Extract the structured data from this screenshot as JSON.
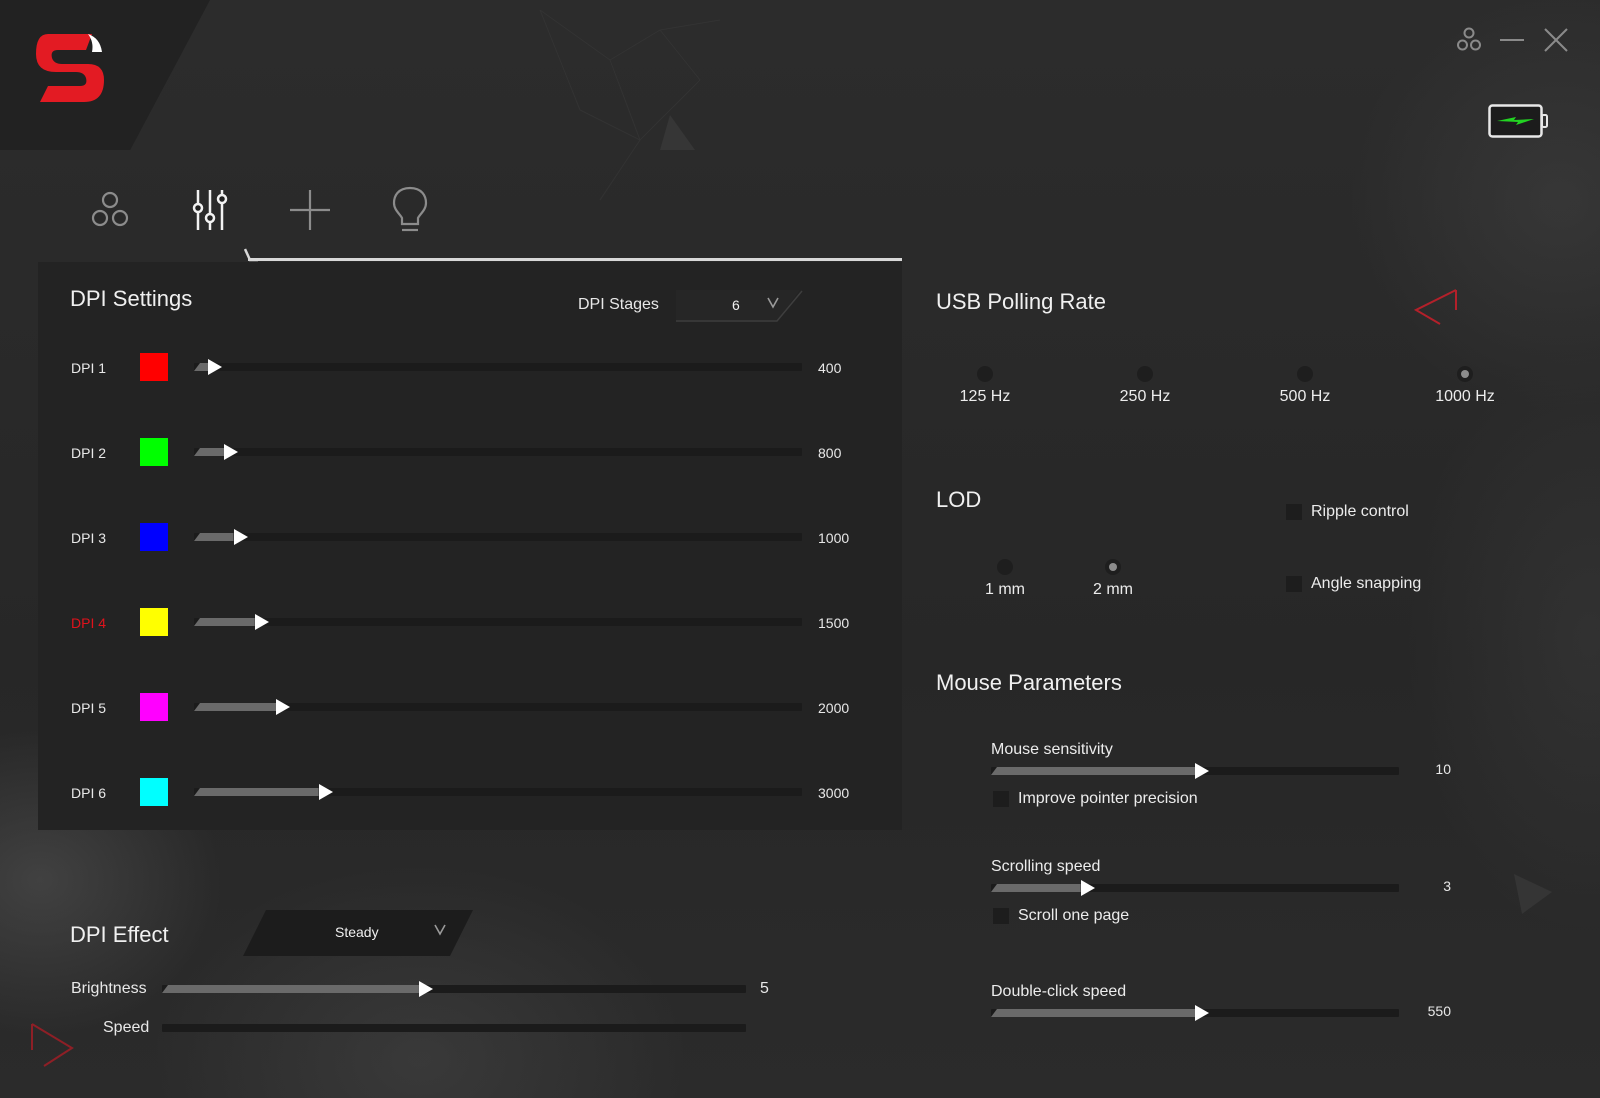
{
  "window": {
    "controls": [
      {
        "name": "profile-switch-icon",
        "label": "profiles"
      },
      {
        "name": "minimize-icon",
        "label": "minimize"
      },
      {
        "name": "close-icon",
        "label": "close"
      }
    ],
    "battery": {
      "state": "charging",
      "color": "#22d322"
    }
  },
  "brand": {
    "logo": "S",
    "logo_color": "#e31b23"
  },
  "tabs": [
    {
      "name": "profiles",
      "icon": "three-circles-icon",
      "active": false
    },
    {
      "name": "performance",
      "icon": "sliders-icon",
      "active": true
    },
    {
      "name": "macros",
      "icon": "plus-icon",
      "active": false
    },
    {
      "name": "lighting",
      "icon": "lightbulb-icon",
      "active": false
    }
  ],
  "dpi_settings": {
    "title": "DPI Settings",
    "stages_label": "DPI Stages",
    "stages_value": "6",
    "active_stage": 4,
    "range": [
      100,
      16000
    ],
    "rows": [
      {
        "label": "DPI 1",
        "color": "#ff0000",
        "value": "400",
        "fraction": 0.02
      },
      {
        "label": "DPI 2",
        "color": "#00ff00",
        "value": "800",
        "fraction": 0.05
      },
      {
        "label": "DPI 3",
        "color": "#0000ff",
        "value": "1000",
        "fraction": 0.065
      },
      {
        "label": "DPI 4",
        "color": "#ffff00",
        "value": "1500",
        "fraction": 0.1
      },
      {
        "label": "DPI 5",
        "color": "#ff00ff",
        "value": "2000",
        "fraction": 0.135
      },
      {
        "label": "DPI 6",
        "color": "#00ffff",
        "value": "3000",
        "fraction": 0.205
      }
    ]
  },
  "dpi_effect": {
    "title": "DPI Effect",
    "selected": "Steady",
    "brightness_label": "Brightness",
    "brightness_value": "5",
    "brightness_fraction": 0.44,
    "speed_label": "Speed",
    "speed_fraction": 0
  },
  "usb_polling": {
    "title": "USB Polling Rate",
    "options": [
      "125 Hz",
      "250 Hz",
      "500 Hz",
      "1000 Hz"
    ],
    "selected": "1000 Hz"
  },
  "lod": {
    "title": "LOD",
    "options": [
      "1 mm",
      "2 mm"
    ],
    "selected": "2 mm"
  },
  "toggles": [
    {
      "label": "Ripple control",
      "checked": false
    },
    {
      "label": "Angle snapping",
      "checked": false
    }
  ],
  "mouse_parameters": {
    "title": "Mouse Parameters",
    "sensitivity": {
      "label": "Mouse sensitivity",
      "value": "10",
      "fraction": 0.5
    },
    "improve_precision": {
      "label": "Improve pointer precision",
      "checked": false
    },
    "scrolling": {
      "label": "Scrolling speed",
      "value": "3",
      "fraction": 0.22
    },
    "scroll_one_page": {
      "label": "Scroll one page",
      "checked": false
    },
    "double_click": {
      "label": "Double-click speed",
      "value": "550",
      "fraction": 0.5
    }
  }
}
